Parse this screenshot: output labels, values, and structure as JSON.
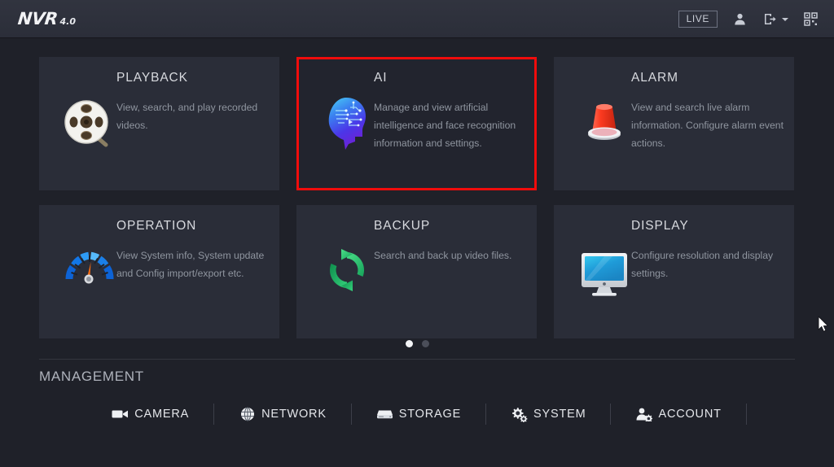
{
  "header": {
    "logo_mark": "NVR",
    "logo_version": "4.0",
    "live_label": "LIVE",
    "icons": {
      "user": "user-icon",
      "logout": "logout-icon",
      "qr": "qr-code-icon"
    }
  },
  "cards": [
    {
      "id": "playback",
      "title": "PLAYBACK",
      "desc": "View, search, and play recorded videos.",
      "icon": "film-reel-search-icon",
      "selected": false
    },
    {
      "id": "ai",
      "title": "AI",
      "desc": "Manage and view artificial intelligence and face recognition information and settings.",
      "icon": "ai-head-circuit-icon",
      "selected": true,
      "highlight_color": "#f00c0c"
    },
    {
      "id": "alarm",
      "title": "ALARM",
      "desc": "View and search live alarm information. Configure alarm event actions.",
      "icon": "alarm-beacon-icon",
      "selected": false
    },
    {
      "id": "operation",
      "title": "OPERATION",
      "desc": "View System info, System update and Config import/export etc.",
      "icon": "gauge-icon",
      "selected": false
    },
    {
      "id": "backup",
      "title": "BACKUP",
      "desc": "Search and back up video files.",
      "icon": "sync-arrows-icon",
      "selected": false
    },
    {
      "id": "display",
      "title": "DISPLAY",
      "desc": "Configure resolution and display settings.",
      "icon": "monitor-icon",
      "selected": false
    }
  ],
  "pagination": {
    "total": 2,
    "active_index": 0
  },
  "management": {
    "title": "MANAGEMENT",
    "items": [
      {
        "label": "CAMERA",
        "icon": "video-camera-icon"
      },
      {
        "label": "NETWORK",
        "icon": "globe-icon"
      },
      {
        "label": "STORAGE",
        "icon": "hard-drive-icon"
      },
      {
        "label": "SYSTEM",
        "icon": "gears-icon"
      },
      {
        "label": "ACCOUNT",
        "icon": "user-gear-icon"
      }
    ]
  },
  "theme": {
    "page_bg": "#1f2129",
    "header_bg": "#2b2e39",
    "card_bg": "#2a2d38",
    "card_selected_bg": "#22242e",
    "accent_red": "#f00c0c",
    "title_color": "#d7d9de",
    "desc_color": "#8f959f"
  }
}
